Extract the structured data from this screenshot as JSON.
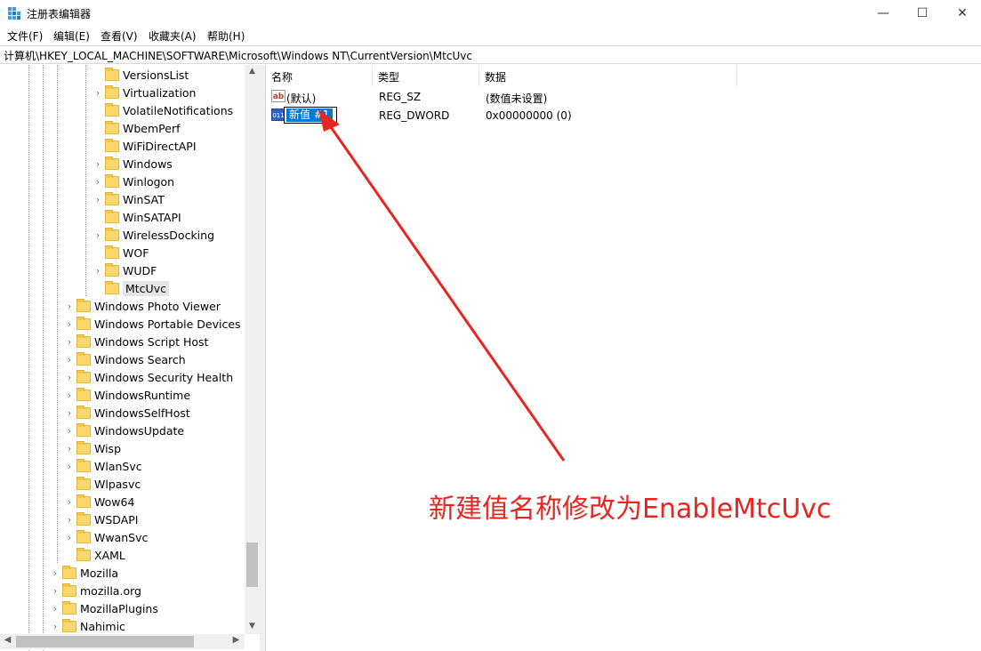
{
  "window": {
    "title": "注册表编辑器",
    "minimize_glyph": "—",
    "maximize_glyph": "☐",
    "close_glyph": "✕"
  },
  "menu": [
    "文件(F)",
    "编辑(E)",
    "查看(V)",
    "收藏夹(A)",
    "帮助(H)"
  ],
  "address": "计算机\\HKEY_LOCAL_MACHINE\\SOFTWARE\\Microsoft\\Windows NT\\CurrentVersion\\MtcUvc",
  "tree": {
    "level3": [
      {
        "label": "VersionsList",
        "expandable": false
      },
      {
        "label": "Virtualization",
        "expandable": true
      },
      {
        "label": "VolatileNotifications",
        "expandable": false
      },
      {
        "label": "WbemPerf",
        "expandable": false
      },
      {
        "label": "WiFiDirectAPI",
        "expandable": false
      },
      {
        "label": "Windows",
        "expandable": true
      },
      {
        "label": "Winlogon",
        "expandable": true
      },
      {
        "label": "WinSAT",
        "expandable": true
      },
      {
        "label": "WinSATAPI",
        "expandable": false
      },
      {
        "label": "WirelessDocking",
        "expandable": true
      },
      {
        "label": "WOF",
        "expandable": false
      },
      {
        "label": "WUDF",
        "expandable": true
      },
      {
        "label": "MtcUvc",
        "expandable": false,
        "selected": true
      }
    ],
    "level2": [
      {
        "label": "Windows Photo Viewer",
        "expandable": true
      },
      {
        "label": "Windows Portable Devices",
        "expandable": true
      },
      {
        "label": "Windows Script Host",
        "expandable": true
      },
      {
        "label": "Windows Search",
        "expandable": true
      },
      {
        "label": "Windows Security Health",
        "expandable": true
      },
      {
        "label": "WindowsRuntime",
        "expandable": true
      },
      {
        "label": "WindowsSelfHost",
        "expandable": true
      },
      {
        "label": "WindowsUpdate",
        "expandable": true
      },
      {
        "label": "Wisp",
        "expandable": true
      },
      {
        "label": "WlanSvc",
        "expandable": true
      },
      {
        "label": "Wlpasvc",
        "expandable": false
      },
      {
        "label": "Wow64",
        "expandable": true
      },
      {
        "label": "WSDAPI",
        "expandable": true
      },
      {
        "label": "WwanSvc",
        "expandable": true
      },
      {
        "label": "XAML",
        "expandable": false
      }
    ],
    "level1": [
      {
        "label": "Mozilla",
        "expandable": true
      },
      {
        "label": "mozilla.org",
        "expandable": true
      },
      {
        "label": "MozillaPlugins",
        "expandable": true
      },
      {
        "label": "Nahimic",
        "expandable": true
      }
    ]
  },
  "list": {
    "columns": [
      "名称",
      "类型",
      "数据"
    ],
    "rows": [
      {
        "icon": "string-value-icon",
        "icon_text": "ab",
        "name": "(默认)",
        "type": "REG_SZ",
        "data": "(数值未设置)"
      },
      {
        "icon": "dword-value-icon",
        "icon_text": "011",
        "name": "新值 #1",
        "type": "REG_DWORD",
        "data": "0x00000000 (0)",
        "editing": true
      }
    ]
  },
  "annotation": {
    "text": "新建值名称修改为EnableMtcUvc",
    "color": "#e8251f"
  }
}
